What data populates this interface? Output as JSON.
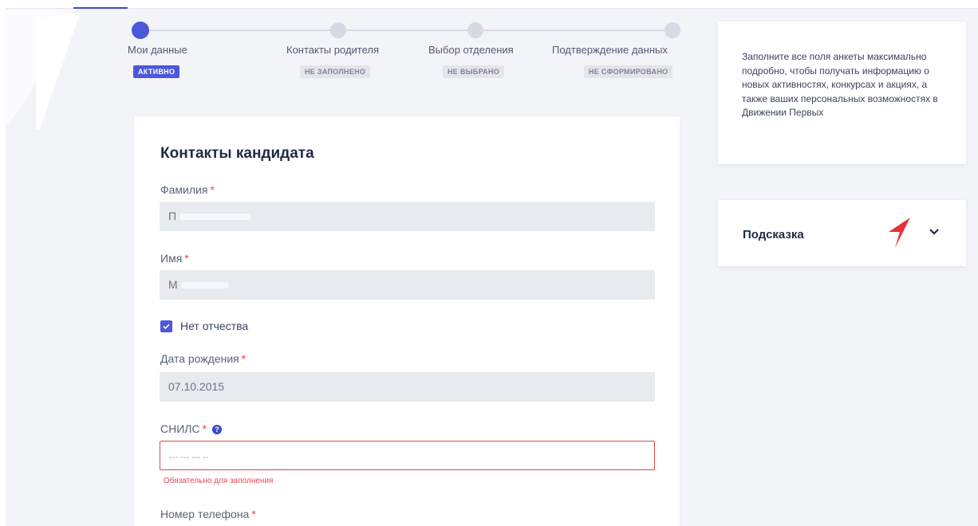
{
  "stepper": {
    "steps": [
      {
        "label": "Мои данные",
        "badge": "АКТИВНО",
        "active": true
      },
      {
        "label": "Контакты родителя",
        "badge": "НЕ ЗАПОЛНЕНО",
        "active": false
      },
      {
        "label": "Выбор отделения",
        "badge": "НЕ ВЫБРАНО",
        "active": false
      },
      {
        "label": "Подтверждение данных",
        "badge": "НЕ СФОРМИРОВАНО",
        "active": false
      }
    ]
  },
  "form": {
    "title": "Контакты кандидата",
    "required_mark": "*",
    "surname": {
      "label": "Фамилия",
      "value": "П"
    },
    "name": {
      "label": "Имя",
      "value": "М"
    },
    "no_patronymic": {
      "label": "Нет отчества",
      "checked": true
    },
    "birth_date": {
      "label": "Дата рождения",
      "value": "07.10.2015"
    },
    "snils": {
      "label": "СНИЛС",
      "placeholder": "--- --- --- --",
      "help_icon": "?",
      "error": "Обязательно для заполнения"
    },
    "phone": {
      "label": "Номер телефона"
    }
  },
  "sidebar": {
    "info_text": "Заполните все поля анкеты максимально подробно, чтобы получать информацию о новых активностях, конкурсах и акциях, а также ваших персональных возможностях в Движении Первых",
    "hint_title": "Подсказка"
  },
  "icons": {
    "check": "check-icon",
    "help": "question-circle-icon",
    "chevron": "chevron-down-icon",
    "logo": "movement-of-the-first-logo-icon"
  },
  "colors": {
    "accent": "#4c57d9",
    "error": "#e5484d",
    "logo_red": "#e8303a",
    "background": "#f3f4f8"
  }
}
